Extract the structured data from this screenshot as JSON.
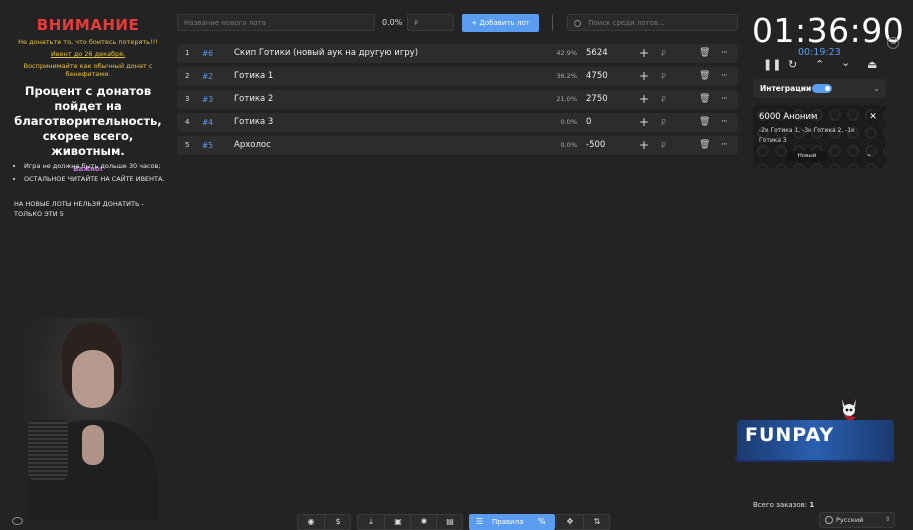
{
  "notice": {
    "title": "ВНИМАНИЕ",
    "line1": "Не донатьте то, что боитесь потерять!!!",
    "line2": "Ивент до 26 декабря.",
    "line3": "Воспринимайте как обычный донат с бенефитами.",
    "main": "Процент с донатов пойдет на благотворительность, скорее всего, животным.",
    "important": "Важно!",
    "bullets": [
      "Игра не должна быть дольше 30 часов;",
      "ОСТАЛЬНОЕ ЧИТАЙТЕ НА САЙТЕ ИВЕНТА."
    ],
    "after": "НА НОВЫЕ ЛОТЫ НЕЛЬЗЯ ДОНАТИТЬ - ТОЛЬКО ЭТИ 5"
  },
  "toolbar": {
    "lot_placeholder": "Название нового лота",
    "percent": "0.0%",
    "currency": "₽",
    "add_label": "Добавить лот",
    "search_placeholder": "Поиск среди лотов..."
  },
  "lots": [
    {
      "num": "1",
      "id": "#6",
      "name": "Скип Готики (новый аук на другую игру)",
      "pct": "42.9%",
      "amount": "5624"
    },
    {
      "num": "2",
      "id": "#2",
      "name": "Готика 1",
      "pct": "36.2%",
      "amount": "4750"
    },
    {
      "num": "3",
      "id": "#3",
      "name": "Готика 2",
      "pct": "21.0%",
      "amount": "2750"
    },
    {
      "num": "4",
      "id": "#4",
      "name": "Готика 3",
      "pct": "0.0%",
      "amount": "0"
    },
    {
      "num": "5",
      "id": "#5",
      "name": "Архолос",
      "pct": "0.0%",
      "amount": "-500"
    }
  ],
  "row_actions": {
    "plus": "+",
    "currency": "₽",
    "trash": "🗑",
    "more": "···"
  },
  "timer": {
    "main": "01:36:90",
    "sub": "00:19:23",
    "badge": "Ts"
  },
  "integrations": {
    "label": "Интеграции",
    "enabled": true
  },
  "donation_card": {
    "title": "6000 Аноним",
    "desc": "-2к Готика 1, -3к Готика 2, -1к Готика 3",
    "chip": "Новый",
    "close": "✕"
  },
  "banner": {
    "text": "FUNPAY"
  },
  "orders": {
    "label": "Всего заказов:",
    "count": "1"
  },
  "language": {
    "selected": "Русский"
  },
  "bottom": {
    "rules_label": "Правила",
    "percent_sign": "%"
  },
  "colors": {
    "accent": "#5a9cf0",
    "warning": "#e53b3b",
    "note": "#e8c23a",
    "important": "#c977e6",
    "background": "#232323"
  }
}
